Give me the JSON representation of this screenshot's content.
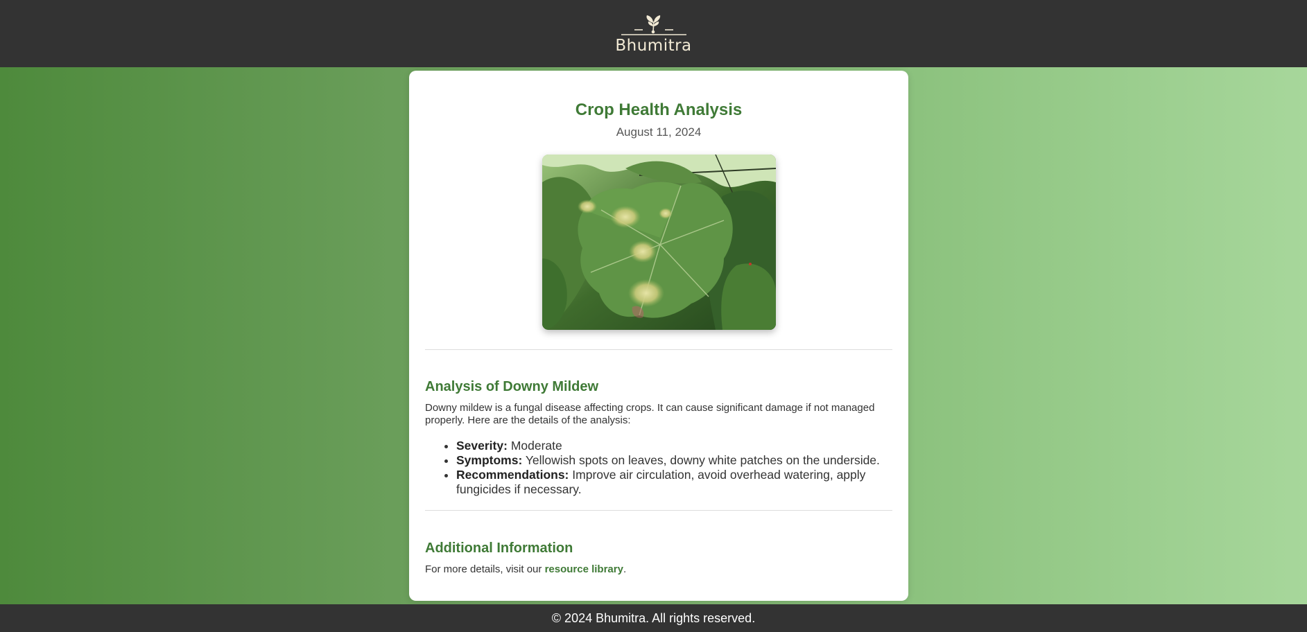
{
  "brand": {
    "name": "Bhumitra",
    "logo_icon": "sprout-icon"
  },
  "report": {
    "title": "Crop Health Analysis",
    "date": "August 11, 2024",
    "image_alt": "Grape leaf with yellowish downy mildew spots"
  },
  "analysis": {
    "heading": "Analysis of Downy Mildew",
    "intro": "Downy mildew is a fungal disease affecting crops. It can cause significant damage if not managed properly. Here are the details of the analysis:",
    "details": [
      {
        "label": "Severity:",
        "value": "Moderate"
      },
      {
        "label": "Symptoms:",
        "value": "Yellowish spots on leaves, downy white patches on the underside."
      },
      {
        "label": "Recommendations:",
        "value": "Improve air circulation, avoid overhead watering, apply fungicides if necessary."
      }
    ]
  },
  "additional": {
    "heading": "Additional Information",
    "text_before": "For more details, visit our ",
    "link_label": "resource library",
    "text_after": "."
  },
  "footer": {
    "copyright": "© 2024 Bhumitra. All rights reserved."
  },
  "colors": {
    "header_bg": "#333333",
    "accent_green": "#3f7a36",
    "logo_cream": "#f2ead5"
  }
}
